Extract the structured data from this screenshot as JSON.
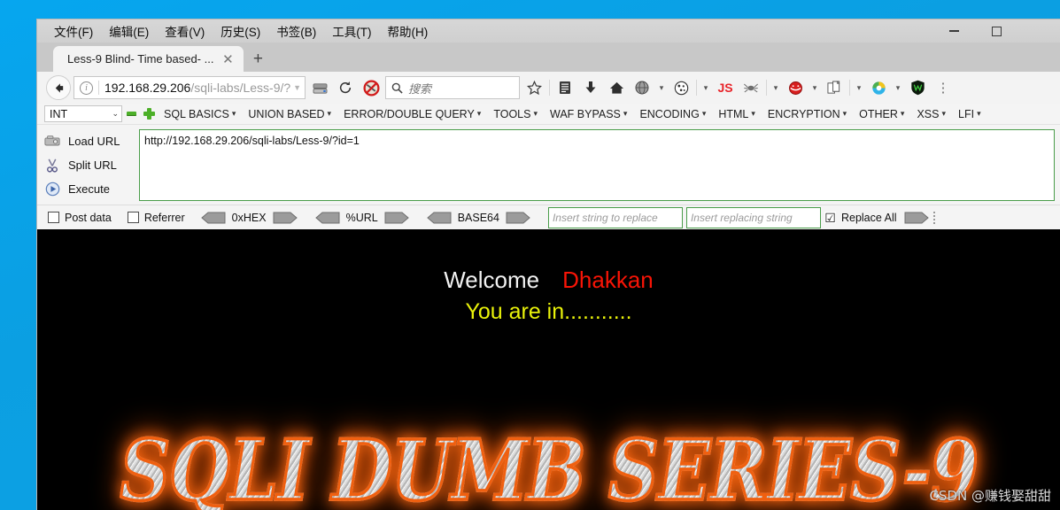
{
  "window": {
    "menus": [
      {
        "label": "文件(F)",
        "accel": "F"
      },
      {
        "label": "编辑(E)",
        "accel": "E"
      },
      {
        "label": "查看(V)",
        "accel": "V"
      },
      {
        "label": "历史(S)",
        "accel": "S"
      },
      {
        "label": "书签(B)",
        "accel": "B"
      },
      {
        "label": "工具(T)",
        "accel": "T"
      },
      {
        "label": "帮助(H)",
        "accel": "H"
      }
    ],
    "controls": {
      "minimize": "—",
      "maximize": "□",
      "close": "✕"
    }
  },
  "tabs": {
    "active_title": "Less-9 Blind- Time based- ...",
    "close_glyph": "✕",
    "new_tab_glyph": "+"
  },
  "nav": {
    "back_glyph": "←",
    "info_glyph": "i",
    "url_host": "192.168.29.206",
    "url_path": "/sqli-labs/Less-9/?",
    "url_caret": "▼",
    "reload_glyph": "⟳",
    "search_placeholder": "搜索",
    "search_icon_glyph": "🔍",
    "icons": [
      {
        "name": "server-icon",
        "glyph": "▤"
      },
      {
        "name": "bookmark-star-icon",
        "glyph": "☆"
      },
      {
        "name": "reader-view-icon",
        "glyph": "▤"
      },
      {
        "name": "downloads-icon",
        "glyph": "⬇"
      },
      {
        "name": "home-icon",
        "glyph": "⌂"
      },
      {
        "name": "globe-icon",
        "glyph": "◍"
      },
      {
        "name": "cookie-icon",
        "glyph": "◉"
      },
      {
        "name": "javascript-icon",
        "glyph": "JS"
      },
      {
        "name": "spider-icon",
        "glyph": "🕷"
      },
      {
        "name": "hackbar-icon",
        "glyph": "◉"
      },
      {
        "name": "page-copy-icon",
        "glyph": "❐"
      },
      {
        "name": "browser-globe-icon",
        "glyph": "◍"
      },
      {
        "name": "wappalyzer-shield-icon",
        "glyph": "W"
      },
      {
        "name": "overflow-menu-icon",
        "glyph": "⋮"
      }
    ]
  },
  "hackbar": {
    "type_select": {
      "value": "INT",
      "caret": "⌄"
    },
    "decrement": "−",
    "increment": "+",
    "menus": [
      "SQL BASICS",
      "UNION BASED",
      "ERROR/DOUBLE QUERY",
      "TOOLS",
      "WAF BYPASS",
      "ENCODING",
      "HTML",
      "ENCRYPTION",
      "OTHER",
      "XSS",
      "LFI"
    ],
    "caret": "▾",
    "actions": [
      {
        "label": "Load URL",
        "icon": "load-url-icon"
      },
      {
        "label": "Split URL",
        "icon": "split-url-icon"
      },
      {
        "label": "Execute",
        "icon": "execute-icon"
      }
    ],
    "url_value": "http://192.168.29.206/sqli-labs/Less-9/?id=1",
    "checkboxes": [
      {
        "label": "Post data",
        "checked": false
      },
      {
        "label": "Referrer",
        "checked": false
      }
    ],
    "encoders": [
      "0xHEX",
      "%URL",
      "BASE64"
    ],
    "replace_find_placeholder": "Insert string to replace",
    "replace_with_placeholder": "Insert replacing string",
    "replace_all": {
      "label": "Replace All",
      "checked": true,
      "glyph": "☑"
    }
  },
  "page": {
    "welcome_word": "Welcome",
    "welcome_name": "Dhakkan",
    "status_line": "You are in...........",
    "logo_text": "SQLI DUMB SERIES-9",
    "watermark": "CSDN @赚钱娶甜甜",
    "colors": {
      "welcome": "#f2f2f2",
      "name": "#f81406",
      "status": "#e9f20a",
      "logo_stroke": "#f06010",
      "background": "#000000"
    }
  }
}
